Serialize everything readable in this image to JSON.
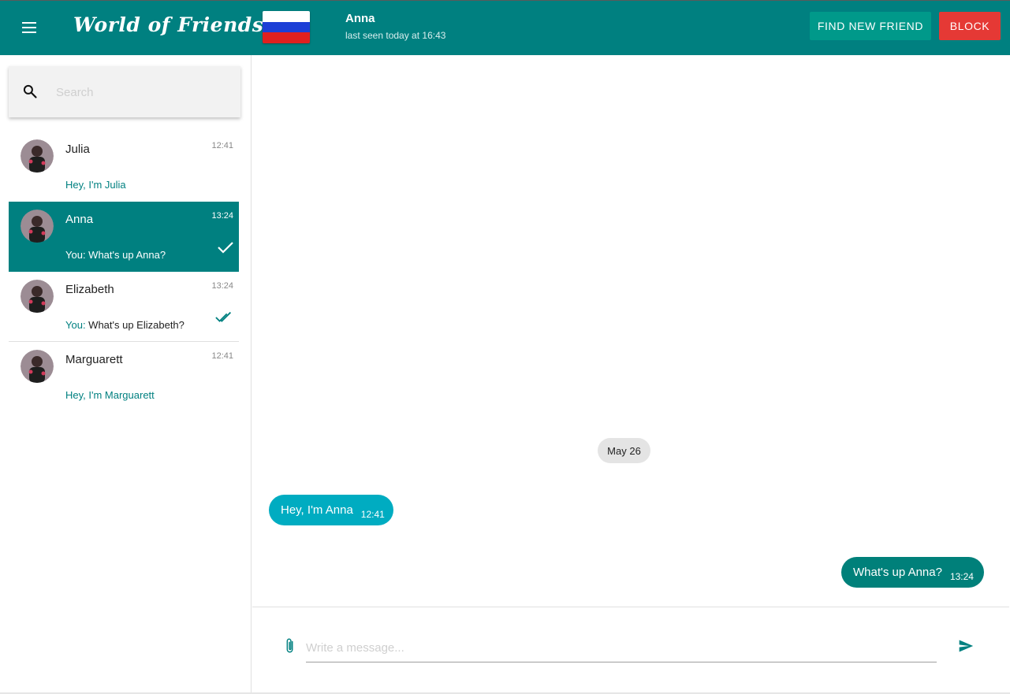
{
  "app": {
    "title": "World of Friends"
  },
  "header": {
    "contact_name": "Anna",
    "contact_status": "last seen today at 16:43",
    "flag": "russia-flag",
    "find_button": "FIND NEW FRIEND",
    "block_button": "BLOCK"
  },
  "search": {
    "placeholder": "Search",
    "value": ""
  },
  "chats": [
    {
      "name": "Julia",
      "time": "12:41",
      "preview": "Hey, I'm Julia",
      "status": "none",
      "selected": false
    },
    {
      "name": "Anna",
      "time": "13:24",
      "preview_prefix": "You: ",
      "preview": "What's up Anna?",
      "status": "sent",
      "selected": true
    },
    {
      "name": "Elizabeth",
      "time": "13:24",
      "preview_prefix": "You: ",
      "preview": "What's up Elizabeth?",
      "status": "read",
      "selected": false
    },
    {
      "name": "Marguarett",
      "time": "12:41",
      "preview": "Hey, I'm Marguarett",
      "status": "none",
      "selected": false
    }
  ],
  "conversation": {
    "date_label": "May 26",
    "messages": [
      {
        "direction": "in",
        "text": "Hey, I'm Anna",
        "time": "12:41"
      },
      {
        "direction": "out",
        "text": "What's up Anna?",
        "time": "13:24"
      }
    ]
  },
  "composer": {
    "placeholder": "Write a message...",
    "value": ""
  },
  "colors": {
    "primary": "#008080",
    "accent": "#00998a",
    "danger": "#e53935",
    "incoming_bubble": "#00acc1",
    "outgoing_bubble": "#00807a"
  }
}
